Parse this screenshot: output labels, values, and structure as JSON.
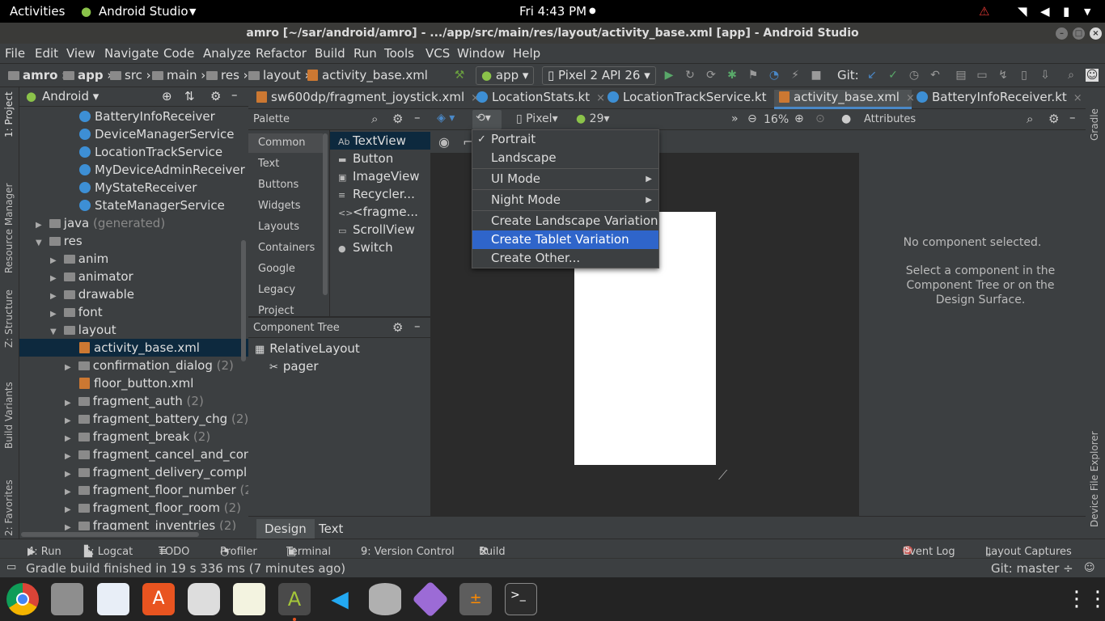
{
  "topbar": {
    "activities": "Activities",
    "app_name": "Android Studio",
    "clock": "Fri  4:43 PM"
  },
  "titlebar": {
    "title": "amro [~/sar/android/amro] - .../app/src/main/res/layout/activity_base.xml [app] - Android Studio"
  },
  "menubar": [
    "File",
    "Edit",
    "View",
    "Navigate",
    "Code",
    "Analyze",
    "Refactor",
    "Build",
    "Run",
    "Tools",
    "VCS",
    "Window",
    "Help"
  ],
  "breadcrumbs": [
    "amro",
    "app",
    "src",
    "main",
    "res",
    "layout",
    "activity_base.xml"
  ],
  "toolbar": {
    "run_config": "app",
    "device": "Pixel 2 API 26",
    "git_label": "Git:"
  },
  "left_strip": {
    "project": "1: Project",
    "resource_manager": "Resource Manager",
    "structure": "Z: Structure",
    "build_variants": "Build Variants",
    "favorites": "2: Favorites"
  },
  "right_strip": {
    "gradle": "Gradle",
    "device_file_explorer": "Device File Explorer"
  },
  "project": {
    "view": "Android",
    "rows": [
      {
        "label": "BatteryInfoReceiver",
        "count": ""
      },
      {
        "label": "DeviceManagerService",
        "count": ""
      },
      {
        "label": "LocationTrackService",
        "count": ""
      },
      {
        "label": "MyDeviceAdminReceiver",
        "count": ""
      },
      {
        "label": "MyStateReceiver",
        "count": ""
      },
      {
        "label": "StateManagerService",
        "count": ""
      },
      {
        "label": "java",
        "count": "(generated)"
      },
      {
        "label": "res",
        "count": ""
      },
      {
        "label": "anim",
        "count": ""
      },
      {
        "label": "animator",
        "count": ""
      },
      {
        "label": "drawable",
        "count": ""
      },
      {
        "label": "font",
        "count": ""
      },
      {
        "label": "layout",
        "count": ""
      },
      {
        "label": "activity_base.xml",
        "count": ""
      },
      {
        "label": "confirmation_dialog",
        "count": "(2)"
      },
      {
        "label": "floor_button.xml",
        "count": ""
      },
      {
        "label": "fragment_auth",
        "count": "(2)"
      },
      {
        "label": "fragment_battery_chg",
        "count": "(2)"
      },
      {
        "label": "fragment_break",
        "count": "(2)"
      },
      {
        "label": "fragment_cancel_and_conti",
        "count": ""
      },
      {
        "label": "fragment_delivery_compl",
        "count": "(2"
      },
      {
        "label": "fragment_floor_number",
        "count": "(2)"
      },
      {
        "label": "fragment_floor_room",
        "count": "(2)"
      },
      {
        "label": "fragment_inventries",
        "count": "(2)"
      }
    ]
  },
  "editor_tabs": [
    "sw600dp/fragment_joystick.xml",
    "LocationStats.kt",
    "LocationTrackService.kt",
    "activity_base.xml",
    "BatteryInfoReceiver.kt"
  ],
  "palette": {
    "title": "Palette",
    "categories": [
      "Common",
      "Text",
      "Buttons",
      "Widgets",
      "Layouts",
      "Containers",
      "Google",
      "Legacy",
      "Project"
    ],
    "items": [
      {
        "icon": "Ab",
        "label": "TextView"
      },
      {
        "icon": "▬",
        "label": "Button"
      },
      {
        "icon": "▣",
        "label": "ImageView"
      },
      {
        "icon": "≡",
        "label": "Recycler..."
      },
      {
        "icon": "<>",
        "label": "<fragme..."
      },
      {
        "icon": "▭",
        "label": "ScrollView"
      },
      {
        "icon": "●",
        "label": "Switch"
      }
    ]
  },
  "component_tree": {
    "title": "Component Tree",
    "items": [
      "RelativeLayout",
      "pager"
    ]
  },
  "design_toolbar": {
    "device": "Pixel",
    "api": "29",
    "zoom": "16%"
  },
  "orientation_menu": {
    "items": [
      "Portrait",
      "Landscape",
      "UI Mode",
      "Night Mode",
      "Create Landscape Variation",
      "Create Tablet Variation",
      "Create Other..."
    ]
  },
  "attributes": {
    "title": "Attributes",
    "empty": "No component selected.",
    "hint": "Select a component in the Component Tree or on the Design Surface."
  },
  "bottom_tabs": [
    "Design",
    "Text"
  ],
  "tool_windows": {
    "run": "4: Run",
    "logcat": "6: Logcat",
    "todo": "TODO",
    "profiler": "Profiler",
    "terminal": "Terminal",
    "vcs": "9: Version Control",
    "build": "Build",
    "event_log": "Event Log",
    "layout_captures": "Layout Captures"
  },
  "status": {
    "message": "Gradle build finished in 19 s 336 ms (7 minutes ago)",
    "git": "Git: master ÷"
  },
  "dock_apps": [
    "chrome",
    "files",
    "document-viewer",
    "software-store",
    "disk-tool",
    "text-editor",
    "android-studio",
    "vscode",
    "database",
    "cube-app",
    "calculator",
    "terminal"
  ]
}
